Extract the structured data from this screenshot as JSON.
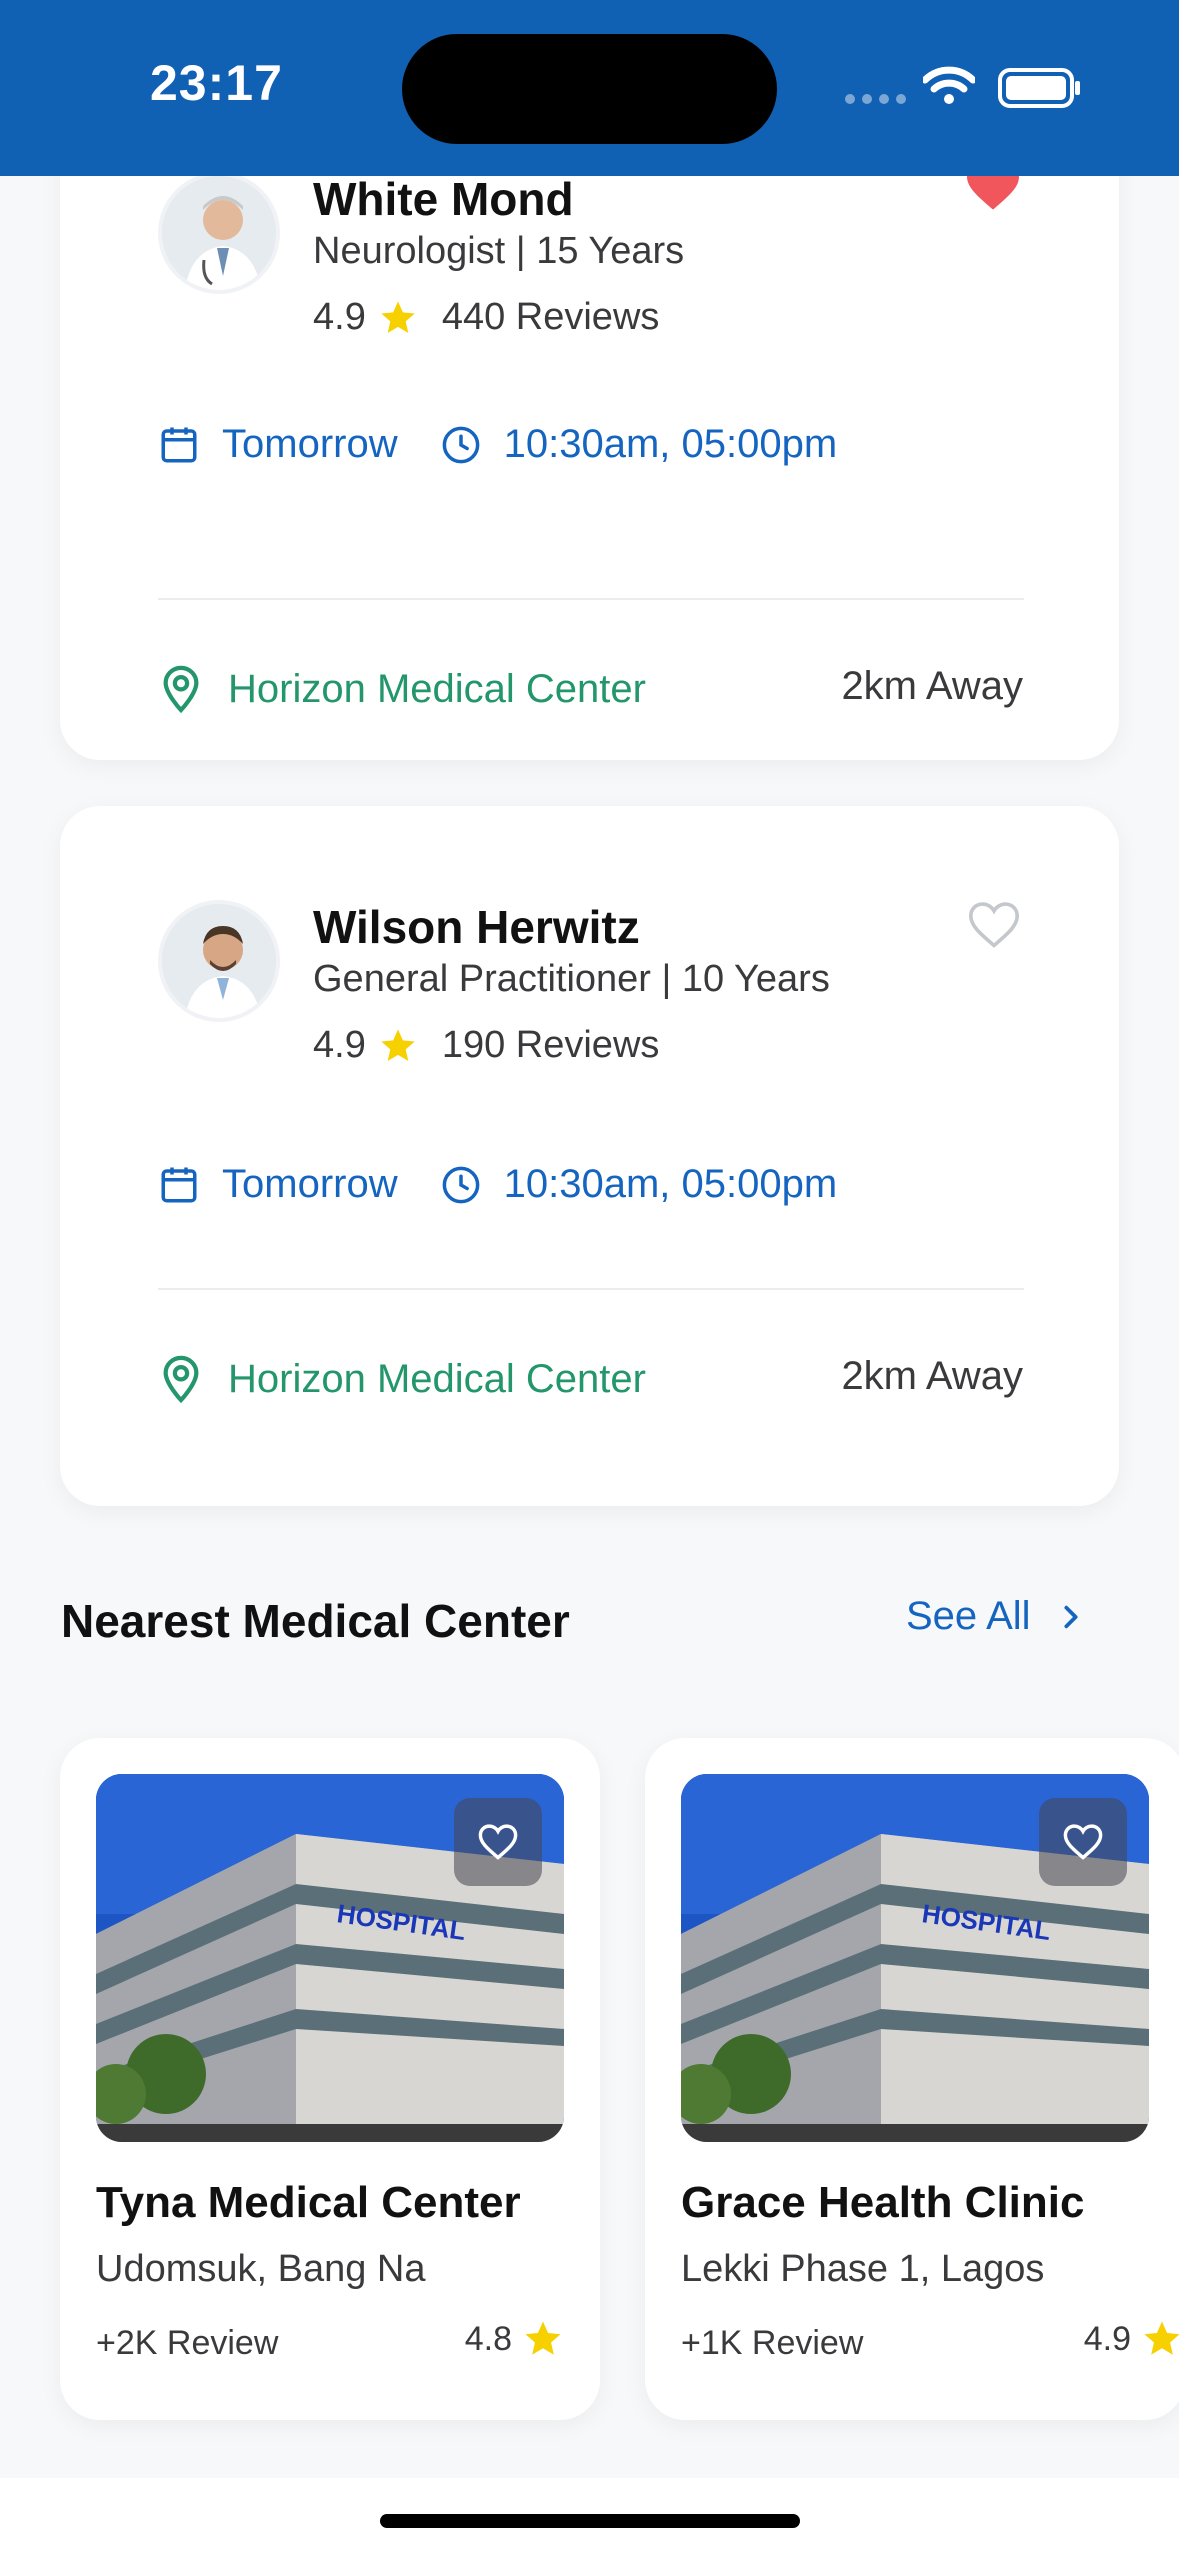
{
  "status_bar": {
    "time": "23:17"
  },
  "doctors": [
    {
      "name": "White Mond",
      "specialty": "Neurologist | 15 Years",
      "rating": "4.9",
      "reviews": "440 Reviews",
      "favorited": true,
      "day": "Tomorrow",
      "times": "10:30am, 05:00pm",
      "location": "Horizon Medical Center",
      "distance": "2km Away"
    },
    {
      "name": "Wilson Herwitz",
      "specialty": "General Practitioner | 10 Years",
      "rating": "4.9",
      "reviews": "190 Reviews",
      "favorited": false,
      "day": "Tomorrow",
      "times": "10:30am, 05:00pm",
      "location": "Horizon Medical Center",
      "distance": "2km Away"
    }
  ],
  "section": {
    "title": "Nearest Medical Center",
    "see_all": "See All"
  },
  "medical_centers": [
    {
      "name": "Tyna Medical Center",
      "address": "Udomsuk, Bang Na",
      "reviews": "+2K Review",
      "rating": "4.8",
      "image_label": "HOSPITAL"
    },
    {
      "name": "Grace Health Clinic",
      "address": "Lekki Phase 1, Lagos",
      "reviews": "+1K Review",
      "rating": "4.9",
      "image_label": "HOSPITAL"
    }
  ],
  "colors": {
    "header": "#1060b4",
    "accent_blue": "#1565c0",
    "accent_green": "#23966b",
    "favorite_red": "#f0565c",
    "star": "#f7d000"
  },
  "icons": [
    "wifi-icon",
    "battery-icon",
    "heart-icon",
    "star-icon",
    "calendar-icon",
    "clock-icon",
    "location-pin-icon",
    "chevron-right-icon"
  ]
}
